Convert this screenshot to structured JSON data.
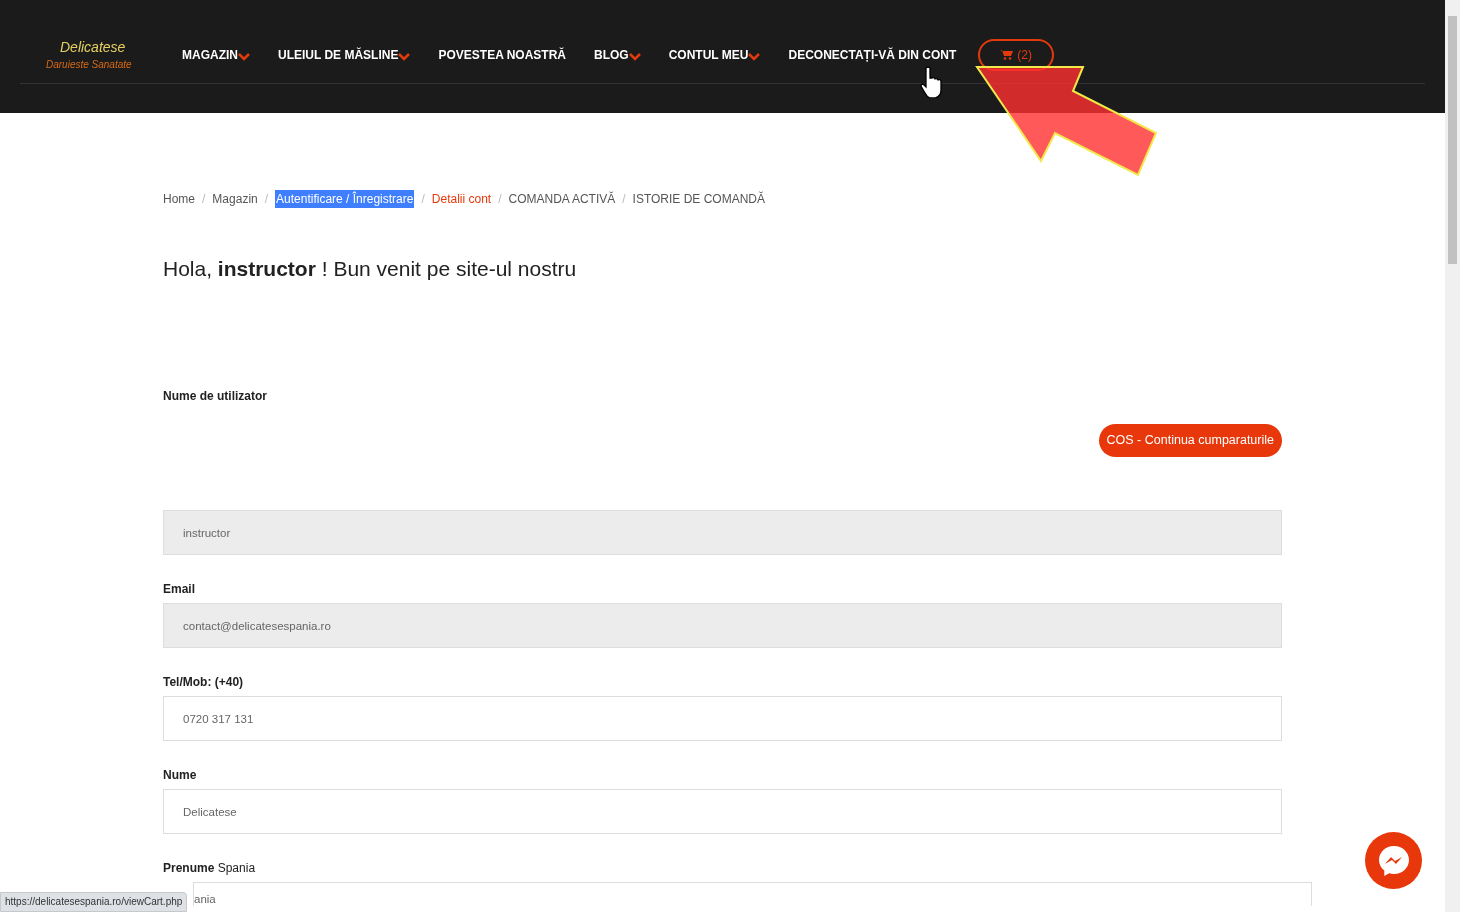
{
  "logo": {
    "name": "Delicatese",
    "tagline": "Daruieste Sanatate"
  },
  "nav": [
    {
      "label": "MAGAZIN",
      "dropdown": true
    },
    {
      "label": "ULEIUL DE MĂSLINE",
      "dropdown": true
    },
    {
      "label": "POVESTEA NOASTRĂ",
      "dropdown": false
    },
    {
      "label": "BLOG",
      "dropdown": true
    },
    {
      "label": "CONTUL MEU",
      "dropdown": true
    },
    {
      "label": "DECONECTAȚI-VĂ DIN CONT",
      "dropdown": false
    }
  ],
  "cart": {
    "count": "(2)"
  },
  "breadcrumbs": [
    {
      "label": "Home",
      "kind": "plain"
    },
    {
      "separator": "/",
      "label": "Magazin",
      "kind": "plain"
    },
    {
      "separator": "/",
      "label": "Autentificare / Înregistrare",
      "kind": "highlighted"
    },
    {
      "separator": "/",
      "label": "Detalii cont",
      "kind": "current"
    },
    {
      "separator": "/",
      "label": "COMANDA ACTIVĂ",
      "kind": "plain"
    },
    {
      "separator": "/",
      "label": "ISTORIE DE COMANDĂ",
      "kind": "plain"
    }
  ],
  "greeting": "Hola, **instructor** ! Bun venit pe site-ul nostru",
  "username_label": "Nume de utilizator",
  "continue_button": "COS - Continua cumparaturile",
  "fields": [
    {
      "value": "instructor",
      "readonly": true
    },
    {
      "label": "Email",
      "value": "contact@delicatesespania.ro",
      "readonly": true
    },
    {
      "label": "Tel/Mob: (+40)",
      "value": "0720 317 131",
      "readonly": false
    },
    {
      "label": "Nume",
      "value": "Delicatese",
      "readonly": false
    },
    {
      "label": "**Prenume** Spania",
      "value": "ania",
      "readonly": false
    }
  ],
  "status_url": "https://delicatesespania.ro/viewCart.php"
}
